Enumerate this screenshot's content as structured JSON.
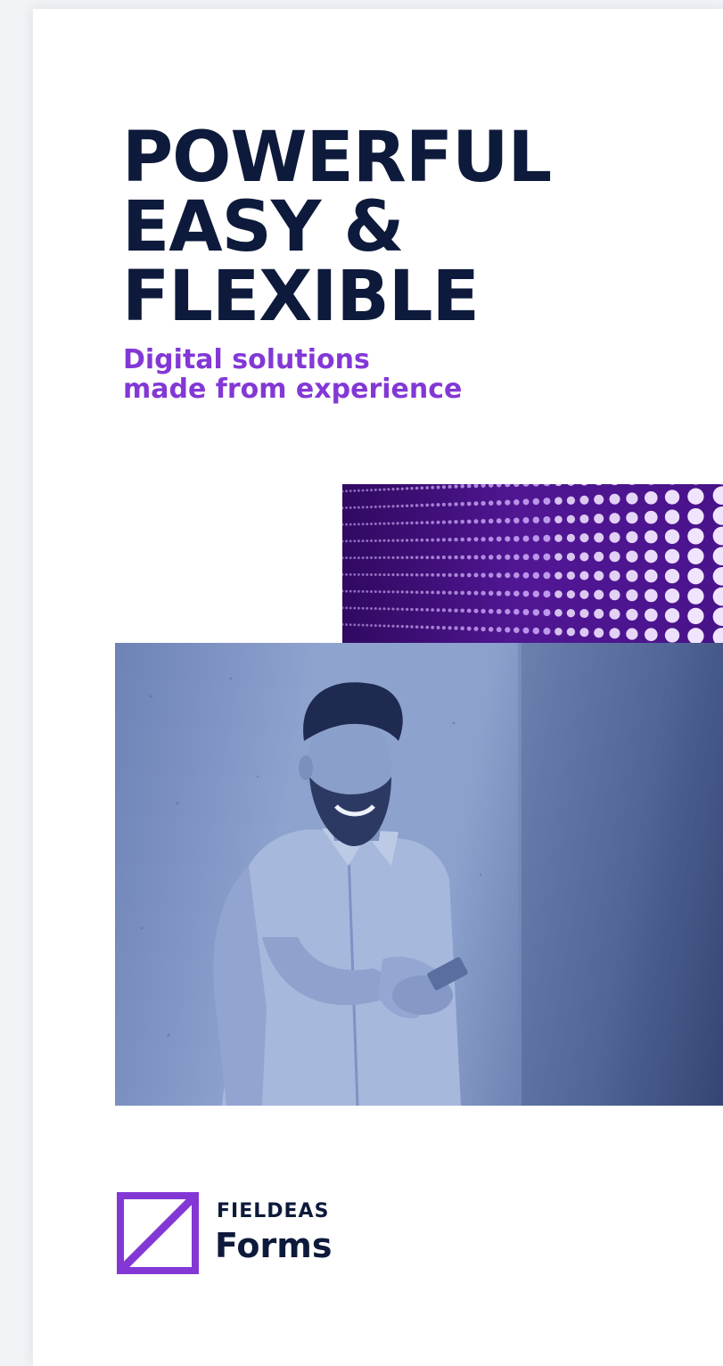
{
  "headline": {
    "line1": "POWERFUL",
    "line2": "EASY &",
    "line3": "FLEXIBLE"
  },
  "subheadline": {
    "line1": "Digital solutions",
    "line2": "made from experience"
  },
  "logo": {
    "brand": "FIELDEAS",
    "product": "Forms"
  },
  "colors": {
    "navy": "#0d1a3b",
    "purple": "#8338d6",
    "led_purple": "#5c1aa8",
    "photo_blue": "#8fa3cf"
  },
  "images": {
    "led": "led-dot-matrix-image",
    "photo": "man-with-phone-photo"
  }
}
